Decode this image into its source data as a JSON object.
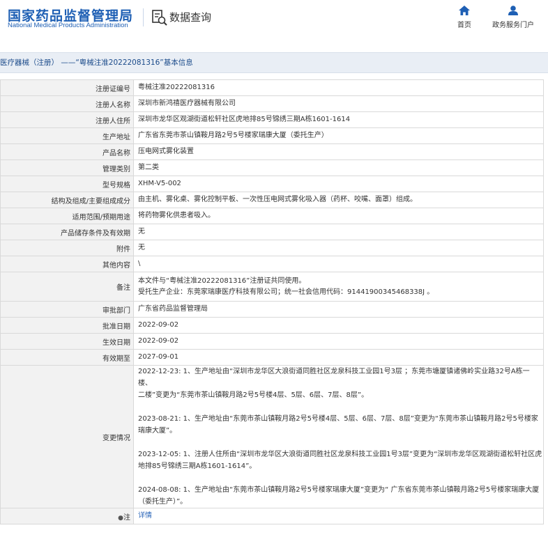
{
  "header": {
    "logo_cn": "国家药品监督管理局",
    "logo_en": "National Medical Products Administration",
    "section_title": "数据查询",
    "nav_home": "首页",
    "nav_portal": "政务服务门户",
    "brand_color": "#1e5fb4"
  },
  "breadcrumb": "医疗器械（注册） ——“粤械注准20222081316”基本信息",
  "fields": [
    {
      "label": "注册证编号",
      "value": "粤械注准20222081316"
    },
    {
      "label": "注册人名称",
      "value": "深圳市新鸿禧医疗器械有限公司"
    },
    {
      "label": "注册人住所",
      "value": "深圳市龙华区观湖街道松轩社区虎地排85号锦绣三期A栋1601-1614"
    },
    {
      "label": "生产地址",
      "value": "广东省东莞市茶山镇鞍月路2号5号楼家瑞康大厦（委托生产）"
    },
    {
      "label": "产品名称",
      "value": "压电网式雾化装置"
    },
    {
      "label": "管理类别",
      "value": "第二类"
    },
    {
      "label": "型号规格",
      "value": "XHM-V5-002"
    },
    {
      "label": "结构及组成/主要组成成分",
      "value": "由主机、雾化桌、雾化控制平板、一次性压电网式雾化吸入器（药杯、咬嘴、面罩）组成。"
    },
    {
      "label": "适用范围/预期用途",
      "value": "将药物雾化供患者吸入。"
    },
    {
      "label": "产品储存条件及有效期",
      "value": "无"
    },
    {
      "label": "附件",
      "value": "无"
    },
    {
      "label": "其他内容",
      "value": "\\"
    }
  ],
  "remark": {
    "label": "备注",
    "line1": "本文件与“粤械注准20222081316”注册证共同使用。",
    "line2": "受托生产企业：东莞家瑞康医疗科技有限公司；统一社会信用代码：91441900345468338J 。"
  },
  "fields2": [
    {
      "label": "审批部门",
      "value": "广东省药品监督管理局"
    },
    {
      "label": "批准日期",
      "value": "2022-09-02"
    },
    {
      "label": "生效日期",
      "value": "2022-09-02"
    },
    {
      "label": "有效期至",
      "value": "2027-09-01"
    }
  ],
  "changes": {
    "label": "变更情况",
    "entries": [
      {
        "l1": "2022-12-23: 1、生产地址由“深圳市龙华区大浪街道同胜社区龙泉科技工业园1号3层 ；东莞市塘厦镇诸佛岭实业路32号A栋一楼、",
        "l2": "二楼”变更为“东莞市茶山镇鞍月路2号5号楼4层、5层、6层、7层、8层”。"
      },
      {
        "l1": "2023-08-21: 1、生产地址由“东莞市茶山镇鞍月路2号5号楼4层、5层、6层、7层、8层”变更为“东莞市茶山镇鞍月路2号5号楼家",
        "l2": "瑞康大厦”。"
      },
      {
        "l1": "2023-12-05: 1、注册人住所由“深圳市龙华区大浪街道同胜社区龙泉科技工业园1号3层”变更为“深圳市龙华区观湖街道松轩社区虎",
        "l2": "地排85号锦绣三期A栋1601-1614”。"
      },
      {
        "l1": "2024-08-08: 1、生产地址由“东莞市茶山镇鞍月路2号5号楼家瑞康大厦”变更为“ 广东省东莞市茶山镇鞍月路2号5号楼家瑞康大厦",
        "l2": "（委托生产）”。"
      }
    ]
  },
  "note": {
    "label": "注",
    "link": "详情"
  }
}
